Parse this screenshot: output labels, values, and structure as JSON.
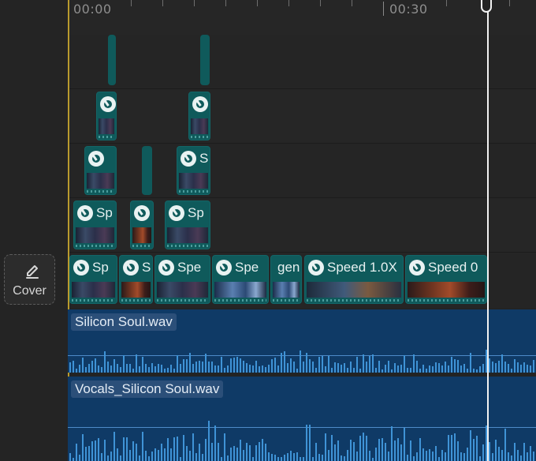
{
  "ruler": {
    "time_start": "00:00",
    "time_mid": "00:30"
  },
  "cover": {
    "label": "Cover",
    "icon": "edit-pencil-icon"
  },
  "video_clips": {
    "c1": "Sp",
    "c2": "S",
    "c3": "Spe",
    "c4": "Spe",
    "c5": "gen",
    "c6": "Speed 1.0X",
    "c7": "Speed 0"
  },
  "overlay_clips": {
    "o1": "Sp",
    "o2": "Sp",
    "o3": "S"
  },
  "audio": {
    "track1": "Silicon Soul.wav",
    "track2": "Vocals_Silicon Soul.wav"
  },
  "colors": {
    "accent_clip": "#0f5a5b",
    "audio_track": "#0f3a66",
    "playhead": "#f2f2f2",
    "start_marker": "#b89a2d"
  }
}
